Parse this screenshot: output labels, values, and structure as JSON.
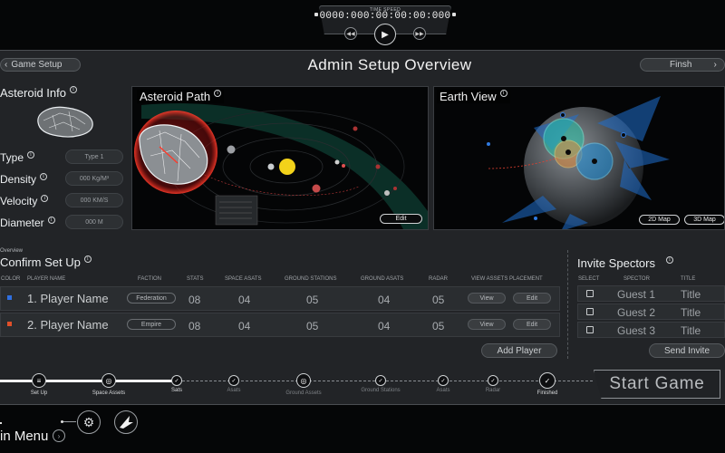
{
  "time_speed": {
    "label": "TIME SPEED",
    "value": "0000:000:00:00:00:000",
    "controls": [
      "rewind-icon",
      "play-icon",
      "fast-forward-icon"
    ]
  },
  "header": {
    "back_label": "Game Setup",
    "title": "Admin Setup Overview",
    "finish_label": "Finsh"
  },
  "asteroid_info": {
    "title": "Asteroid Info",
    "attributes": [
      {
        "label": "Type",
        "value": "Type 1"
      },
      {
        "label": "Density",
        "value": "000 Kg/M³"
      },
      {
        "label": "Velocity",
        "value": "000 KM/S"
      },
      {
        "label": "Diameter",
        "value": "000 M"
      }
    ]
  },
  "asteroid_path": {
    "title": "Asteroid Path",
    "edit_label": "Edit"
  },
  "earth_view": {
    "title": "Earth View",
    "buttons": [
      "2D Map",
      "3D Map"
    ]
  },
  "confirm_setup": {
    "overline": "Overview",
    "title": "Confirm Set Up",
    "columns": [
      "COLOR",
      "PLAYER NAME",
      "FACTION",
      "STATS",
      "SPACE ASATS",
      "GROUND STATIONS",
      "GROUND ASATS",
      "RADAR",
      "VIEW ASSETS PLACEMENT"
    ],
    "rows": [
      {
        "color": "#2f6fe0",
        "name": "1. Player Name",
        "faction": "Federation",
        "stats": "08",
        "space_asats": "04",
        "ground_stations": "05",
        "ground_asats": "04",
        "radar": "05",
        "view": "View",
        "edit": "Edit"
      },
      {
        "color": "#e0502a",
        "name": "2. Player Name",
        "faction": "Empire",
        "stats": "08",
        "space_asats": "04",
        "ground_stations": "05",
        "ground_asats": "04",
        "radar": "05",
        "view": "View",
        "edit": "Edit"
      }
    ],
    "add_player_label": "Add Player"
  },
  "invite": {
    "title": "Invite Spectors",
    "columns": [
      "SELECT",
      "SPECTOR",
      "TITLE"
    ],
    "rows": [
      {
        "name": "Guest 1",
        "title": "Title"
      },
      {
        "name": "Guest 2",
        "title": "Title"
      },
      {
        "name": "Guest 3",
        "title": "Title"
      }
    ],
    "send_label": "Send Invite"
  },
  "progress": {
    "steps": [
      "Set Up",
      "Space Assets",
      "Sats",
      "Asats",
      "Ground Assets",
      "Ground Stations",
      "Asats",
      "Radar",
      "Finished"
    ]
  },
  "start_game_label": "Start Game",
  "footer": {
    "main_menu_label": "in Menu"
  }
}
